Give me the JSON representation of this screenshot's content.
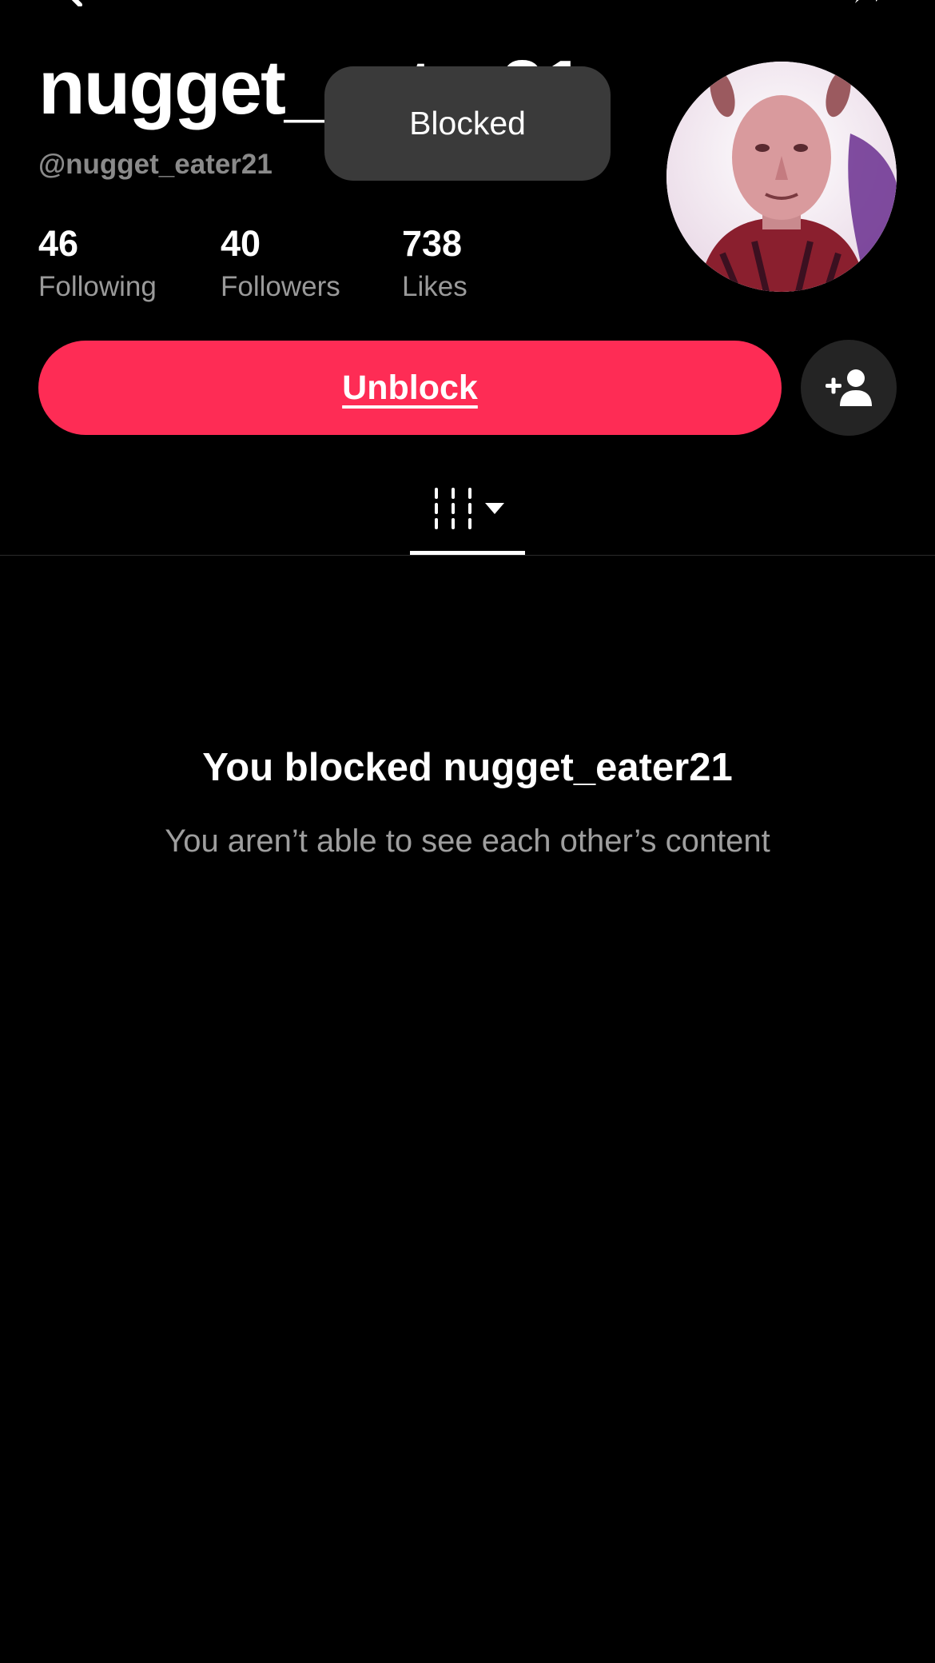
{
  "header": {
    "back_icon": "chevron-left-icon",
    "share_icon": "share-arrow-icon"
  },
  "profile": {
    "display_name": "nugget_eater21",
    "username": "@nugget_eater21",
    "avatar_description": "profile-photo"
  },
  "toast": {
    "label": "Blocked"
  },
  "stats": [
    {
      "value": "46",
      "label": "Following"
    },
    {
      "value": "40",
      "label": "Followers"
    },
    {
      "value": "738",
      "label": "Likes"
    }
  ],
  "actions": {
    "unblock_label": "Unblock",
    "add_friend_icon": "add-person-icon"
  },
  "tabs": {
    "grid_icon": "videos-grid-icon",
    "dropdown_icon": "caret-down-icon"
  },
  "blocked_state": {
    "title": "You blocked nugget_eater21",
    "subtitle": "You aren’t able to see each other’s content"
  },
  "colors": {
    "background": "#000000",
    "accent": "#fe2c55",
    "toast": "#3a3a3a",
    "secondary_text": "#9a9a9a"
  }
}
